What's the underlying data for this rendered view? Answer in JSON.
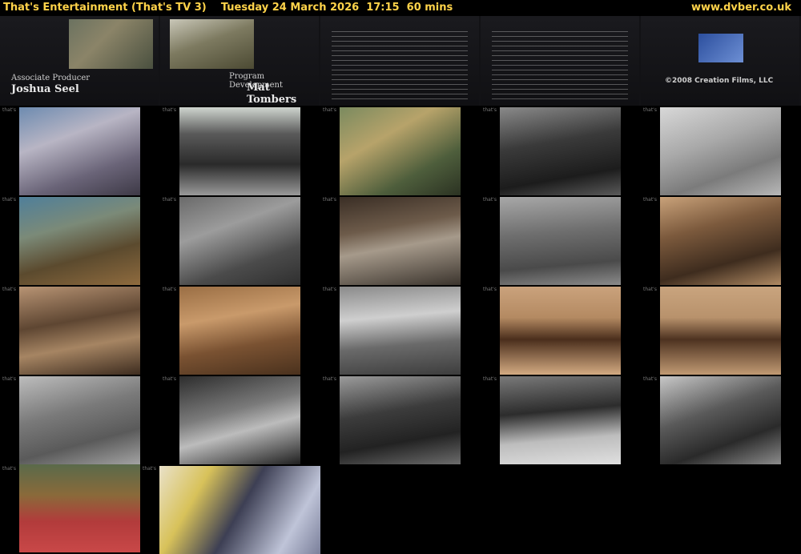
{
  "header": {
    "title": "That's Entertainment (That's TV 3)    Tuesday 24 March 2026  17:15  60 mins",
    "site": "www.dvber.co.uk"
  },
  "credits": {
    "associate_producer_role": "Associate Producer",
    "associate_producer_name": "Joshua Seel",
    "program_development_role": "Program Development",
    "program_development_name": "Mat Tombers",
    "copyright": "©2008 Creation Films, LLC"
  },
  "thumb_marker": "that's"
}
